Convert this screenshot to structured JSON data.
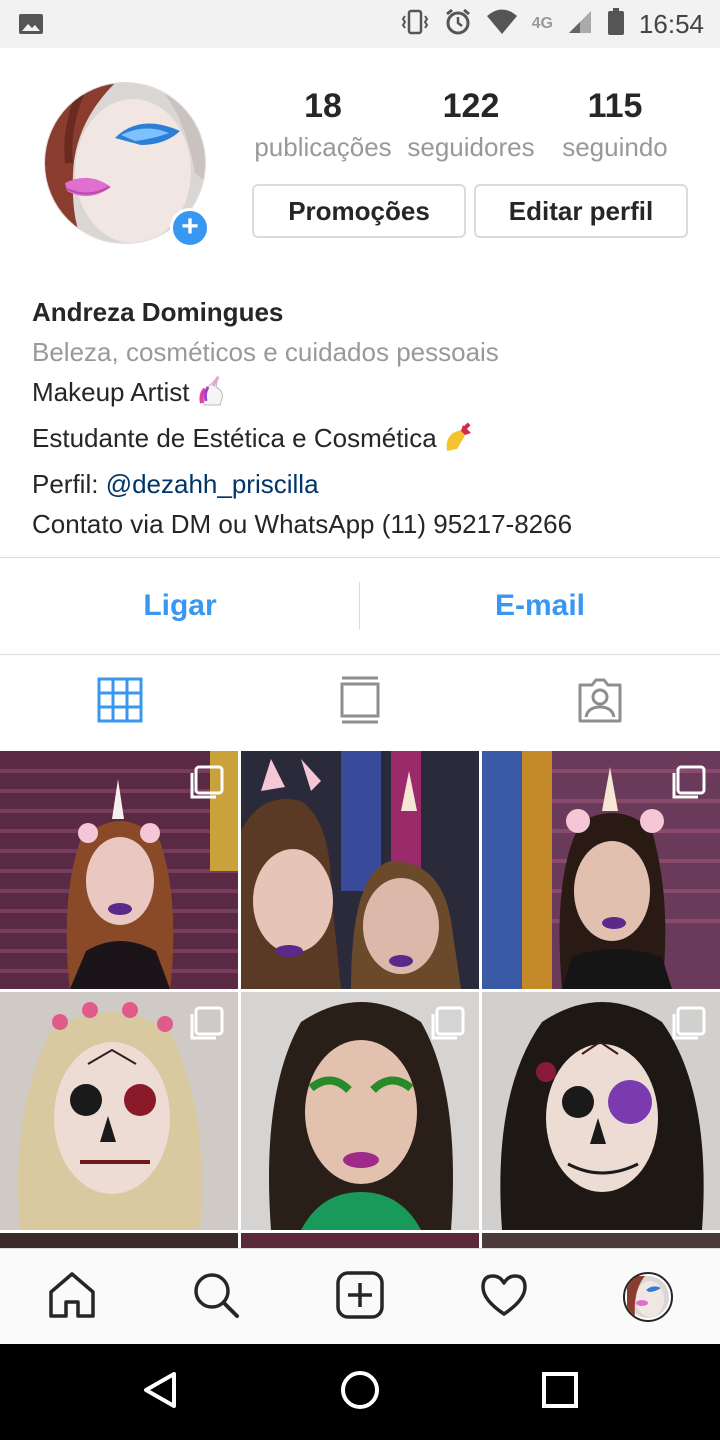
{
  "status_bar": {
    "time": "16:54",
    "network": "4G",
    "icons": [
      "image-icon",
      "vibrate-icon",
      "alarm-icon",
      "wifi-icon",
      "signal-icon",
      "battery-icon"
    ]
  },
  "profile": {
    "stats": [
      {
        "value": "18",
        "label": "publicações"
      },
      {
        "value": "122",
        "label": "seguidores"
      },
      {
        "value": "115",
        "label": "seguindo"
      }
    ],
    "promo_button": "Promoções",
    "edit_button": "Editar perfil",
    "name": "Andreza Domingues",
    "category": "Beleza, cosméticos e cuidados pessoais",
    "bio_line1": "Makeup Artist",
    "bio_line2": "Estudante de Estética e Cosmética",
    "bio_line3_prefix": "Perfil: ",
    "bio_line3_link": "@dezahh_priscilla",
    "bio_line4": "Contato via DM ou WhatsApp (11) 95217-8266"
  },
  "contact": {
    "call": "Ligar",
    "email": "E-mail"
  },
  "tabs": [
    "grid-icon",
    "feed-icon",
    "tagged-icon"
  ],
  "grid_posts": [
    {
      "theme": "unicorn makeup, purple shutter wall",
      "multiple": true
    },
    {
      "theme": "unicorn makeup, two women",
      "multiple": false
    },
    {
      "theme": "unicorn makeup, colorful wall",
      "multiple": true
    },
    {
      "theme": "catrina skull makeup, flower crown",
      "multiple": true
    },
    {
      "theme": "green glitter eyelashes makeup",
      "multiple": true
    },
    {
      "theme": "catrina skull makeup, purple eye",
      "multiple": true
    }
  ],
  "bottom_nav": [
    "home-icon",
    "search-icon",
    "new-post-icon",
    "activity-heart-icon",
    "profile-avatar"
  ],
  "colors": {
    "accent": "#3897f0",
    "link": "#003569",
    "muted": "#999999",
    "border": "#dbdbdb"
  }
}
